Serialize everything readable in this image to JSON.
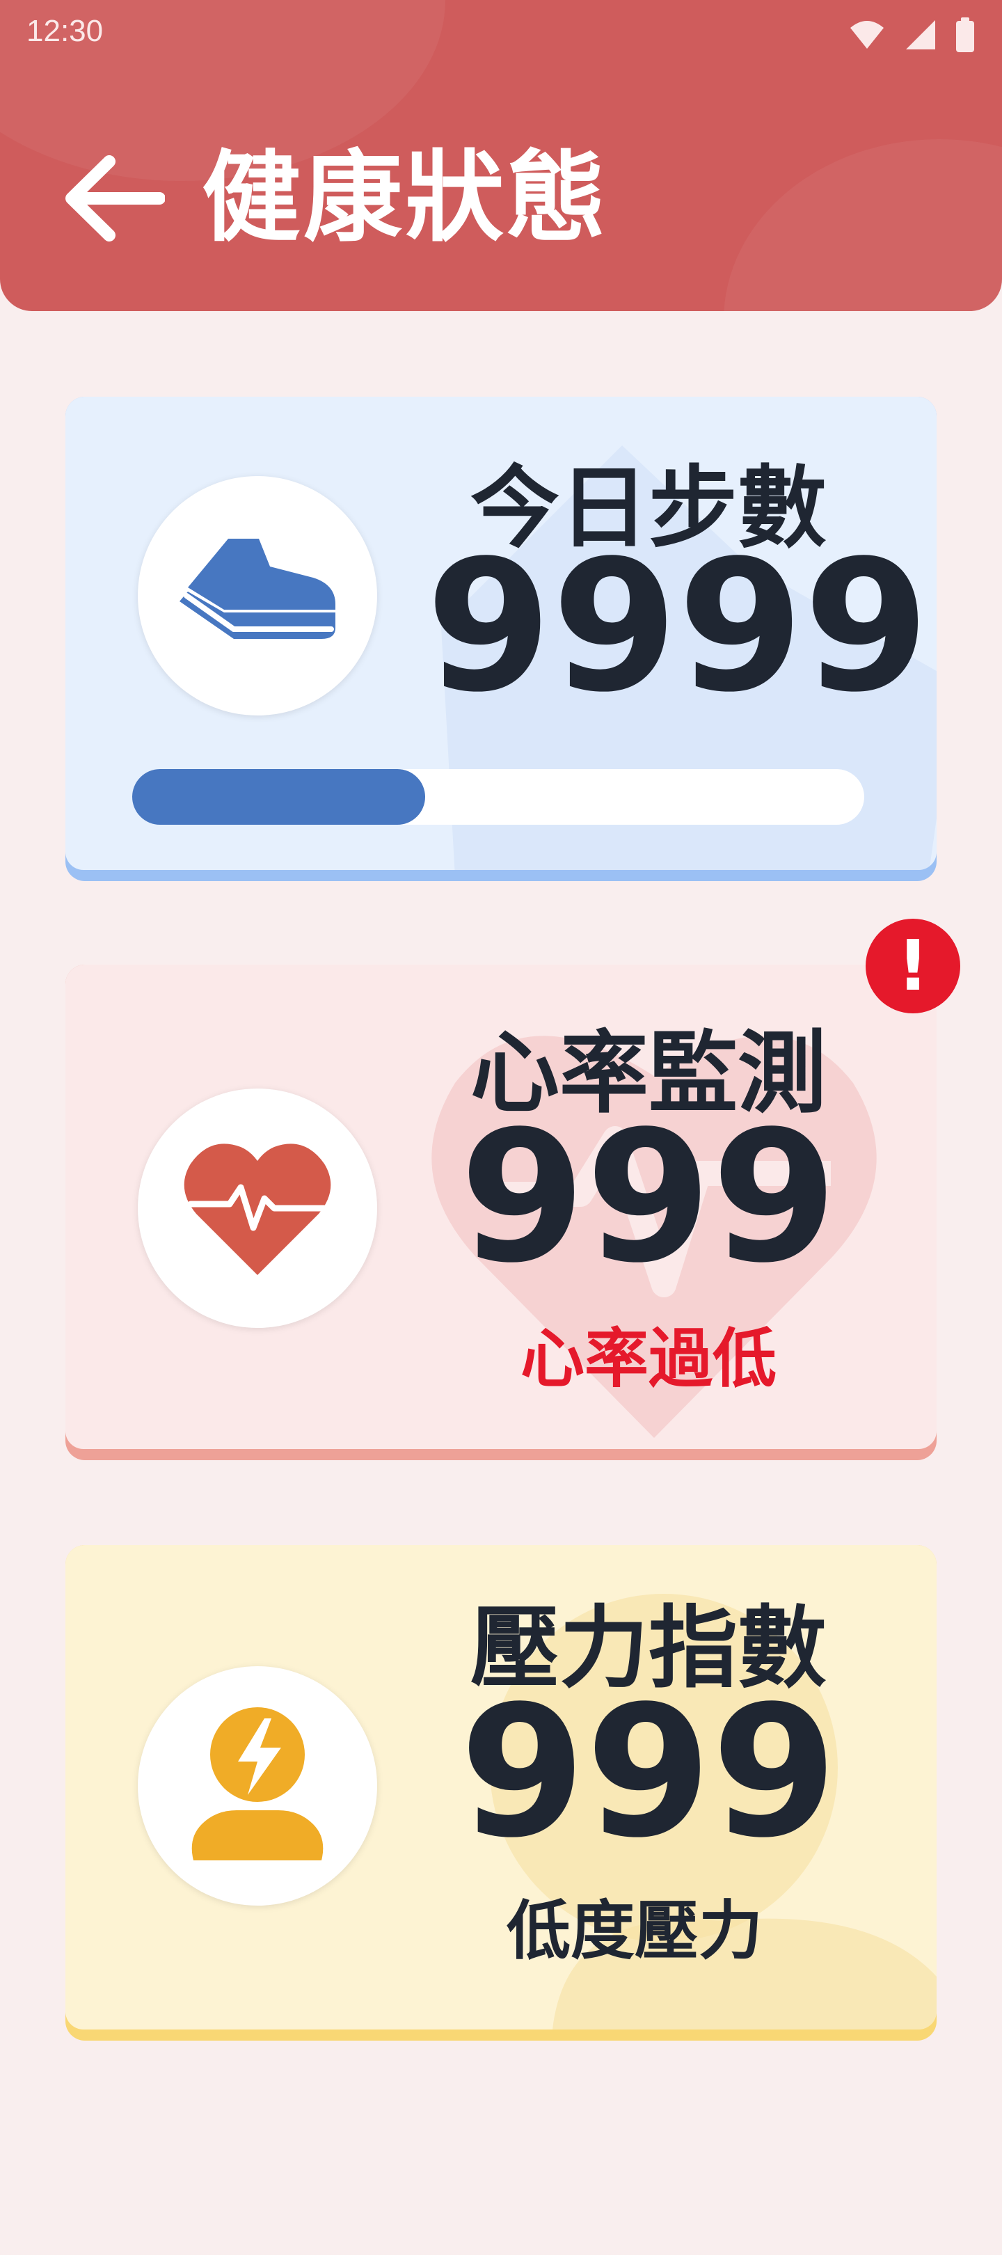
{
  "status_bar": {
    "time": "12:30"
  },
  "header": {
    "title": "健康狀態"
  },
  "steps": {
    "label": "今日步數",
    "value": "9999",
    "progress_fraction": 0.4,
    "icon": "shoe-icon",
    "accent": "#4777c1"
  },
  "heart_rate": {
    "label": "心率監測",
    "value": "999",
    "status": "心率過低",
    "status_color": "#e5192b",
    "icon": "heart-pulse-icon"
  },
  "stress": {
    "label": "壓力指數",
    "value": "999",
    "status": "低度壓力",
    "icon": "stress-person-icon"
  },
  "alert": {
    "symbol": "!"
  }
}
